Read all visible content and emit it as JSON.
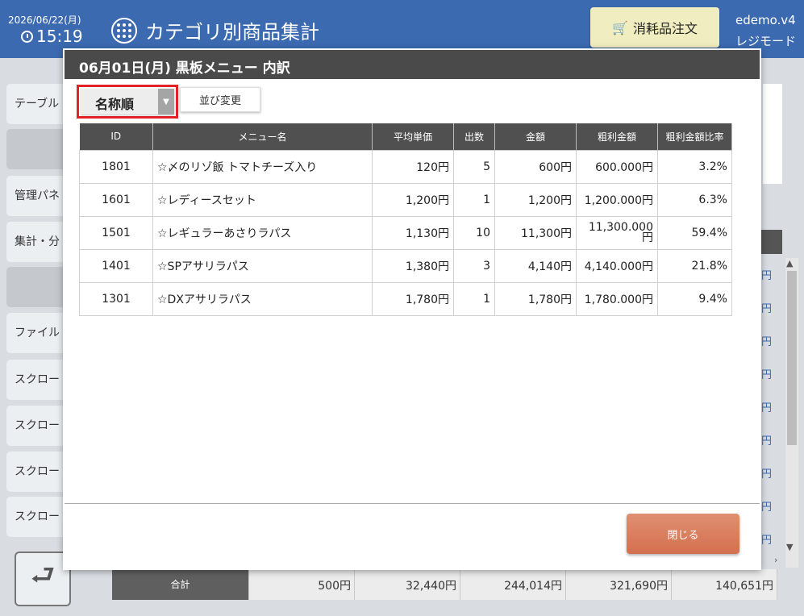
{
  "header": {
    "date": "2026/06/22(月)",
    "time": "15:19",
    "title": "カテゴリ別商品集計",
    "order_button": "消耗品注文",
    "user": "edemo.v4",
    "mode": "レジモード"
  },
  "sidebar": {
    "items": [
      {
        "label": "テーブル",
        "dark": false
      },
      {
        "label": "",
        "dark": true
      },
      {
        "label": "管理パネ",
        "dark": false
      },
      {
        "label": "集計・分",
        "dark": false
      },
      {
        "label": "",
        "dark": true
      },
      {
        "label": "ファイル",
        "dark": false
      },
      {
        "label": "スクロー",
        "dark": false
      },
      {
        "label": "スクロー",
        "dark": false
      },
      {
        "label": "スクロー",
        "dark": false
      },
      {
        "label": "スクロー",
        "dark": false
      }
    ]
  },
  "background": {
    "yen_cells": [
      "円",
      "円",
      "円",
      "円",
      "円",
      "円",
      "円",
      "円",
      "円"
    ],
    "totals": {
      "label": "合計",
      "values": [
        "500円",
        "32,440円",
        "244,014円",
        "321,690円",
        "140,651円"
      ]
    }
  },
  "modal": {
    "title": "06月01日(月) 黒板メニュー 内訳",
    "sort_select": "名称順",
    "reorder_button": "並び変更",
    "columns": [
      "ID",
      "メニュー名",
      "平均単価",
      "出数",
      "金額",
      "粗利金額",
      "粗利金額比率"
    ],
    "rows": [
      {
        "id": "1801",
        "name": "☆〆のリゾ飯 トマトチーズ入り",
        "avg": "120円",
        "qty": "5",
        "amount": "600円",
        "profit": "600.000円",
        "ratio": "3.2%"
      },
      {
        "id": "1601",
        "name": "☆レディースセット",
        "avg": "1,200円",
        "qty": "1",
        "amount": "1,200円",
        "profit": "1,200.000円",
        "ratio": "6.3%"
      },
      {
        "id": "1501",
        "name": "☆レギュラーあさりラパス",
        "avg": "1,130円",
        "qty": "10",
        "amount": "11,300円",
        "profit": "11,300.000円",
        "ratio": "59.4%"
      },
      {
        "id": "1401",
        "name": "☆SPアサリラパス",
        "avg": "1,380円",
        "qty": "3",
        "amount": "4,140円",
        "profit": "4,140.000円",
        "ratio": "21.8%"
      },
      {
        "id": "1301",
        "name": "☆DXアサリラパス",
        "avg": "1,780円",
        "qty": "1",
        "amount": "1,780円",
        "profit": "1,780.000円",
        "ratio": "9.4%"
      }
    ],
    "close_button": "閉じる"
  }
}
